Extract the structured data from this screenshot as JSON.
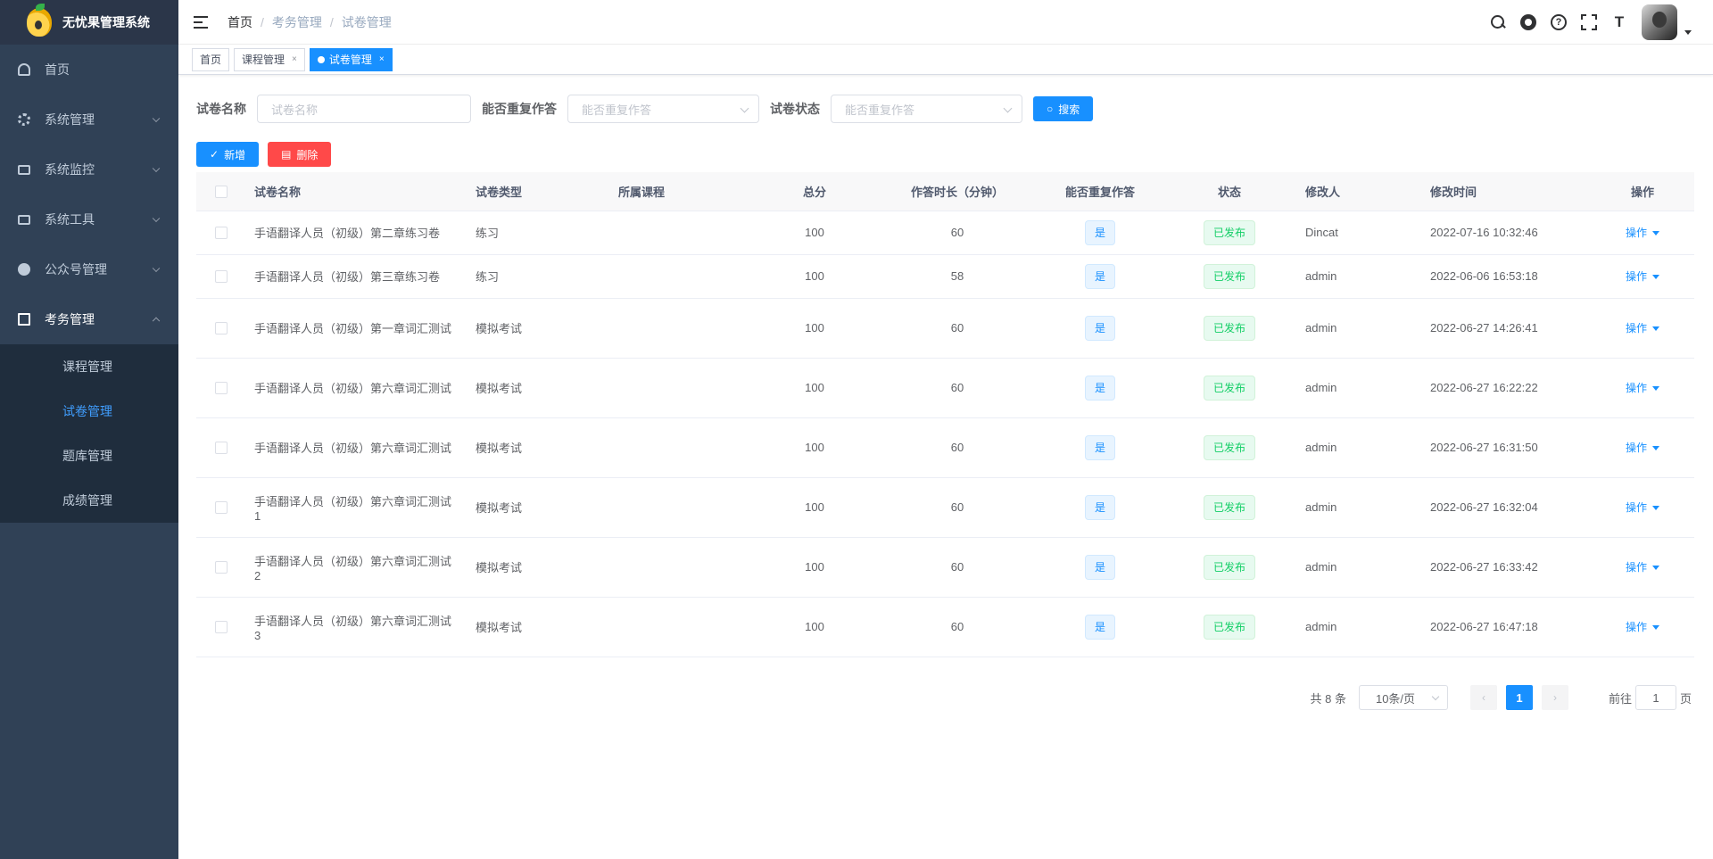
{
  "app": {
    "title": "无忧果管理系统"
  },
  "sidebar": {
    "items": [
      {
        "label": "首页"
      },
      {
        "label": "系统管理"
      },
      {
        "label": "系统监控"
      },
      {
        "label": "系统工具"
      },
      {
        "label": "公众号管理"
      },
      {
        "label": "考务管理"
      }
    ],
    "subitems": [
      {
        "label": "课程管理"
      },
      {
        "label": "试卷管理"
      },
      {
        "label": "题库管理"
      },
      {
        "label": "成绩管理"
      }
    ]
  },
  "breadcrumb": [
    "首页",
    "考务管理",
    "试卷管理"
  ],
  "tabs": [
    {
      "label": "首页"
    },
    {
      "label": "课程管理",
      "close": "×"
    },
    {
      "label": "试卷管理",
      "close": "×"
    }
  ],
  "search": {
    "name_label": "试卷名称",
    "name_placeholder": "试卷名称",
    "repeat_label": "能否重复作答",
    "repeat_placeholder": "能否重复作答",
    "status_label": "试卷状态",
    "status_placeholder": "能否重复作答",
    "search_button": "搜索"
  },
  "toolbar": {
    "add_label": "新增",
    "delete_label": "删除"
  },
  "table": {
    "headers": [
      "试卷名称",
      "试卷类型",
      "所属课程",
      "总分",
      "作答时长（分钟）",
      "能否重复作答",
      "状态",
      "修改人",
      "修改时间",
      "操作"
    ],
    "rows": [
      {
        "name": "手语翻译人员（初级）第二章练习卷",
        "type": "练习",
        "course": "",
        "score": "100",
        "duration": "60",
        "repeat": "是",
        "status": "已发布",
        "modifier": "Dincat",
        "time": "2022-07-16 10:32:46",
        "op": "操作"
      },
      {
        "name": "手语翻译人员（初级）第三章练习卷",
        "type": "练习",
        "course": "",
        "score": "100",
        "duration": "58",
        "repeat": "是",
        "status": "已发布",
        "modifier": "admin",
        "time": "2022-06-06 16:53:18",
        "op": "操作"
      },
      {
        "name": "手语翻译人员（初级）第一章词汇测试",
        "type": "模拟考试",
        "course": "",
        "score": "100",
        "duration": "60",
        "repeat": "是",
        "status": "已发布",
        "modifier": "admin",
        "time": "2022-06-27 14:26:41",
        "op": "操作"
      },
      {
        "name": "手语翻译人员（初级）第六章词汇测试",
        "type": "模拟考试",
        "course": "",
        "score": "100",
        "duration": "60",
        "repeat": "是",
        "status": "已发布",
        "modifier": "admin",
        "time": "2022-06-27 16:22:22",
        "op": "操作"
      },
      {
        "name": "手语翻译人员（初级）第六章词汇测试",
        "type": "模拟考试",
        "course": "",
        "score": "100",
        "duration": "60",
        "repeat": "是",
        "status": "已发布",
        "modifier": "admin",
        "time": "2022-06-27 16:31:50",
        "op": "操作"
      },
      {
        "name": "手语翻译人员（初级）第六章词汇测试1",
        "type": "模拟考试",
        "course": "",
        "score": "100",
        "duration": "60",
        "repeat": "是",
        "status": "已发布",
        "modifier": "admin",
        "time": "2022-06-27 16:32:04",
        "op": "操作"
      },
      {
        "name": "手语翻译人员（初级）第六章词汇测试2",
        "type": "模拟考试",
        "course": "",
        "score": "100",
        "duration": "60",
        "repeat": "是",
        "status": "已发布",
        "modifier": "admin",
        "time": "2022-06-27 16:33:42",
        "op": "操作"
      },
      {
        "name": "手语翻译人员（初级）第六章词汇测试3",
        "type": "模拟考试",
        "course": "",
        "score": "100",
        "duration": "60",
        "repeat": "是",
        "status": "已发布",
        "modifier": "admin",
        "time": "2022-06-27 16:47:18",
        "op": "操作"
      }
    ]
  },
  "pagination": {
    "total": "共 8 条",
    "page_size": "10条/页",
    "current": "1",
    "jump_prefix": "前往",
    "jump_value": "1",
    "jump_suffix": "页"
  },
  "colors": {
    "sidebar_bg": "#304156",
    "primary": "#1890ff",
    "danger": "#ff4949",
    "success": "#13ce66"
  }
}
